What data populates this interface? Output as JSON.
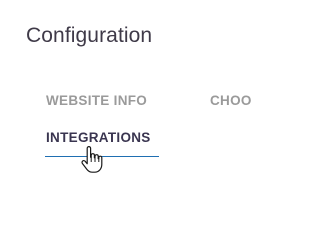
{
  "header": {
    "title": "Configuration"
  },
  "tabs": [
    {
      "label": "WEBSITE INFO",
      "active": false
    },
    {
      "label": "CHOO",
      "active": false
    },
    {
      "label": "INTEGRATIONS",
      "active": true
    }
  ],
  "colors": {
    "title": "#3f3a48",
    "tab_inactive": "#9a9a9a",
    "tab_active": "#3a3550",
    "active_underline": "#1f6fb2"
  },
  "cursor": {
    "icon": "hand-pointer-icon"
  }
}
